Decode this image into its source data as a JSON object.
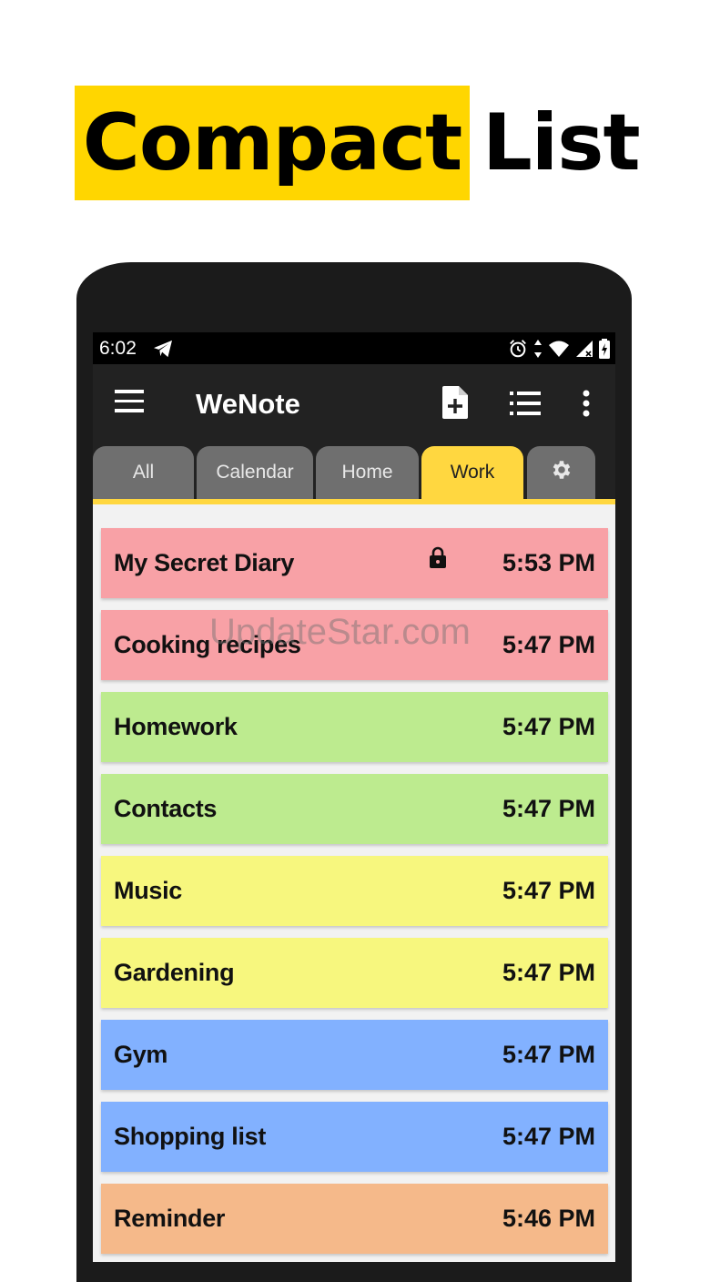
{
  "headline": {
    "highlight": "Compact",
    "plain": "List"
  },
  "status_bar": {
    "time": "6:02",
    "icons": [
      "telegram-icon",
      "alarm-icon",
      "data-arrows-icon",
      "wifi-icon",
      "signal-icon",
      "battery-charging-icon"
    ]
  },
  "app_bar": {
    "title": "WeNote",
    "icons": [
      "menu-icon",
      "new-note-icon",
      "list-view-icon",
      "more-vert-icon"
    ]
  },
  "tabs": [
    {
      "label": "All"
    },
    {
      "label": "Calendar"
    },
    {
      "label": "Home"
    },
    {
      "label": "Work",
      "active": true
    },
    {
      "label": "",
      "icon": "gear-icon"
    }
  ],
  "notes": [
    {
      "title": "My Secret Diary",
      "time": "5:53 PM",
      "color": "#F8A1A6",
      "locked": true
    },
    {
      "title": "Cooking recipes",
      "time": "5:47 PM",
      "color": "#F8A1A6"
    },
    {
      "title": "Homework",
      "time": "5:47 PM",
      "color": "#BDEB8F"
    },
    {
      "title": "Contacts",
      "time": "5:47 PM",
      "color": "#BDEB8F"
    },
    {
      "title": "Music",
      "time": "5:47 PM",
      "color": "#F7F77E"
    },
    {
      "title": "Gardening",
      "time": "5:47 PM",
      "color": "#F7F77E"
    },
    {
      "title": "Gym",
      "time": "5:47 PM",
      "color": "#82B1FF"
    },
    {
      "title": "Shopping list",
      "time": "5:47 PM",
      "color": "#82B1FF"
    },
    {
      "title": "Reminder",
      "time": "5:46 PM",
      "color": "#F5B98A"
    }
  ],
  "watermark": "UpdateStar.com",
  "colors": {
    "accent": "#FFD740",
    "headline_highlight": "#FFD600",
    "frame": "#1b1b1b",
    "toolbar": "#222222"
  }
}
